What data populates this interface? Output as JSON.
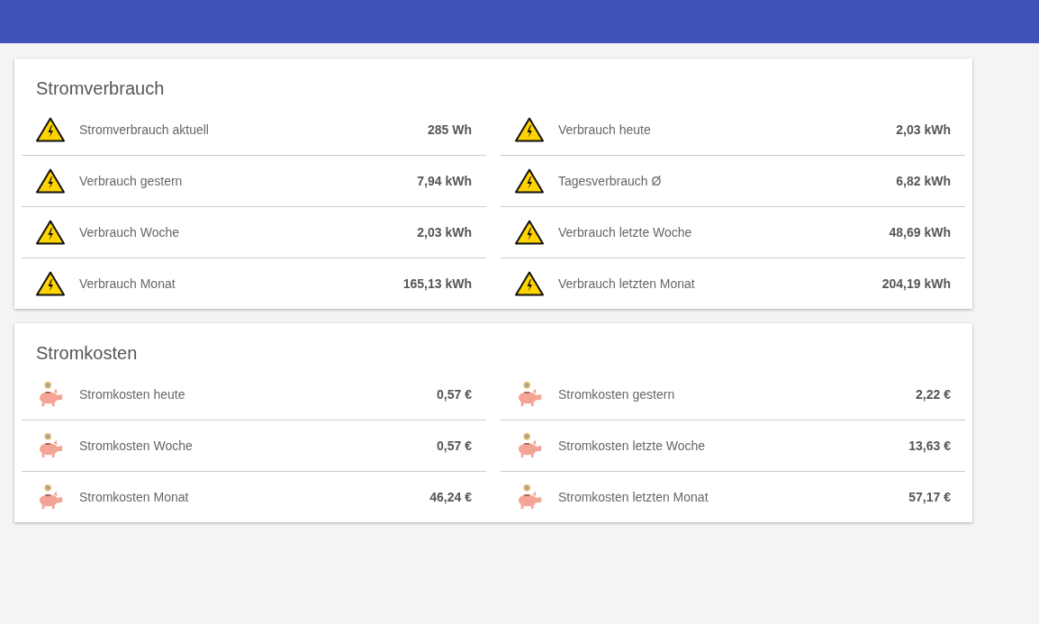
{
  "cards": [
    {
      "title": "Stromverbrauch",
      "kind": "power",
      "items": [
        {
          "label": "Stromverbrauch aktuell",
          "value": "285 Wh"
        },
        {
          "label": "Verbrauch heute",
          "value": "2,03 kWh"
        },
        {
          "label": "Verbrauch gestern",
          "value": "7,94 kWh"
        },
        {
          "label": "Tagesverbrauch Ø",
          "value": "6,82 kWh"
        },
        {
          "label": "Verbrauch Woche",
          "value": "2,03 kWh"
        },
        {
          "label": "Verbrauch letzte Woche",
          "value": "48,69 kWh"
        },
        {
          "label": "Verbrauch Monat",
          "value": "165,13 kWh"
        },
        {
          "label": "Verbrauch letzten Monat",
          "value": "204,19 kWh"
        }
      ]
    },
    {
      "title": "Stromkosten",
      "kind": "cost",
      "items": [
        {
          "label": "Stromkosten heute",
          "value": "0,57 €"
        },
        {
          "label": "Stromkosten gestern",
          "value": "2,22 €"
        },
        {
          "label": "Stromkosten Woche",
          "value": "0,57 €"
        },
        {
          "label": "Stromkosten letzte Woche",
          "value": "13,63 €"
        },
        {
          "label": "Stromkosten Monat",
          "value": "46,24 €"
        },
        {
          "label": "Stromkosten letzten Monat",
          "value": "57,17 €"
        }
      ]
    }
  ]
}
